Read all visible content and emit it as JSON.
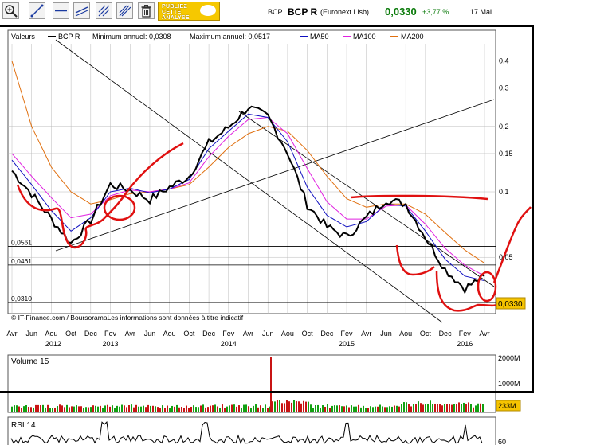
{
  "header": {
    "ticker_small": "BCP",
    "ticker": "BCP R",
    "market": "(Euronext Lisb)",
    "price": "0,0330",
    "change": "+3,77 %",
    "date": "17 Mai"
  },
  "toolbar": {
    "promo_line1": "PUBLIEZ",
    "promo_line2": "CETTE",
    "promo_line3": "ANALYSE",
    "buttons": [
      "zoom-icon",
      "pencil-line-icon",
      "horizontal-line-icon",
      "trend-line-icon",
      "fan-line-icon",
      "trash-icon"
    ]
  },
  "legend": {
    "valeurs": "Valeurs",
    "series_name": "BCP R",
    "min_label": "Minimum annuel: 0,0308",
    "max_label": "Maximum annuel: 0,0517",
    "ma50": "MA50",
    "ma100": "MA100",
    "ma200": "MA200"
  },
  "colors": {
    "price": "#000000",
    "ma50": "#1010c0",
    "ma100": "#e020e0",
    "ma200": "#e07010",
    "annotation": "#e01010",
    "grid": "#b8b8b8",
    "last_price_box": "#f6c400",
    "volume_up": "#12a012",
    "volume_down": "#c81414"
  },
  "chart_data": [
    {
      "type": "line",
      "yscale": "log",
      "ylim": [
        0.028,
        0.46
      ],
      "y_ticks": [
        "0,4",
        "0,3",
        "0,2",
        "0,15",
        "0,1",
        "0,05"
      ],
      "y_tick_values": [
        0.4,
        0.3,
        0.2,
        0.15,
        0.1,
        0.05
      ],
      "x_tick_labels": [
        "Avr",
        "Jun",
        "Aou",
        "Oct",
        "Dec",
        "Fev",
        "Avr",
        "Jun",
        "Aou",
        "Oct",
        "Dec",
        "Fev",
        "Avr",
        "Jun",
        "Aou",
        "Oct",
        "Dec",
        "Fev",
        "Avr",
        "Jun",
        "Aou",
        "Oct",
        "Dec",
        "Fev",
        "Avr"
      ],
      "year_labels": [
        "2012",
        "2013",
        "2014",
        "2015",
        "2016"
      ],
      "reference_lines": [
        {
          "label": "0,0561",
          "value": 0.0561
        },
        {
          "label": "0,0461",
          "value": 0.0461
        },
        {
          "label": "0,0310",
          "value": 0.031
        }
      ],
      "last_price": {
        "label": "0,0330",
        "value": 0.033
      },
      "source": "© IT-Finance.com / BoursoramaLes informations sont données à titre indicatif",
      "series": [
        {
          "name": "BCP R",
          "x": [
            0,
            2,
            4,
            6,
            8,
            10,
            12,
            14,
            16,
            18,
            20,
            22,
            24,
            26,
            28,
            30,
            32,
            34,
            36,
            38,
            40,
            42,
            44,
            46,
            48
          ],
          "values": [
            0.125,
            0.098,
            0.075,
            0.058,
            0.074,
            0.108,
            0.102,
            0.092,
            0.105,
            0.118,
            0.168,
            0.198,
            0.245,
            0.222,
            0.152,
            0.087,
            0.069,
            0.062,
            0.076,
            0.092,
            0.088,
            0.062,
            0.044,
            0.036,
            0.041
          ]
        },
        {
          "name": "MA50",
          "x": [
            0,
            2,
            4,
            6,
            8,
            10,
            12,
            14,
            16,
            18,
            20,
            22,
            24,
            26,
            28,
            30,
            32,
            34,
            36,
            38,
            40,
            42,
            44,
            46,
            48
          ],
          "values": [
            0.14,
            0.108,
            0.082,
            0.066,
            0.076,
            0.1,
            0.104,
            0.099,
            0.103,
            0.114,
            0.158,
            0.19,
            0.228,
            0.22,
            0.17,
            0.105,
            0.078,
            0.069,
            0.073,
            0.088,
            0.086,
            0.066,
            0.049,
            0.041,
            0.039
          ]
        },
        {
          "name": "MA100",
          "x": [
            0,
            2,
            4,
            6,
            8,
            10,
            12,
            14,
            16,
            18,
            20,
            22,
            24,
            26,
            28,
            30,
            32,
            34,
            36,
            38,
            40,
            42,
            44,
            46,
            48
          ],
          "values": [
            0.15,
            0.118,
            0.094,
            0.076,
            0.079,
            0.096,
            0.102,
            0.1,
            0.103,
            0.11,
            0.145,
            0.18,
            0.215,
            0.22,
            0.185,
            0.128,
            0.09,
            0.075,
            0.075,
            0.086,
            0.087,
            0.071,
            0.055,
            0.046,
            0.041
          ]
        },
        {
          "name": "MA200",
          "x": [
            0,
            2,
            4,
            6,
            8,
            10,
            12,
            14,
            16,
            18,
            20,
            22,
            24,
            26,
            28,
            30,
            32,
            34,
            36,
            38,
            40,
            42,
            44,
            46,
            48
          ],
          "values": [
            0.4,
            0.2,
            0.13,
            0.1,
            0.088,
            0.092,
            0.098,
            0.1,
            0.103,
            0.108,
            0.13,
            0.16,
            0.185,
            0.2,
            0.19,
            0.155,
            0.118,
            0.093,
            0.085,
            0.088,
            0.088,
            0.079,
            0.065,
            0.054,
            0.047
          ]
        }
      ]
    },
    {
      "type": "bar",
      "title": "Volume 15",
      "y_ticks": [
        "2000M",
        "1000M"
      ],
      "last_value": "233M"
    },
    {
      "type": "line",
      "title": "RSI 14",
      "y_ticks": [
        "60"
      ]
    }
  ]
}
